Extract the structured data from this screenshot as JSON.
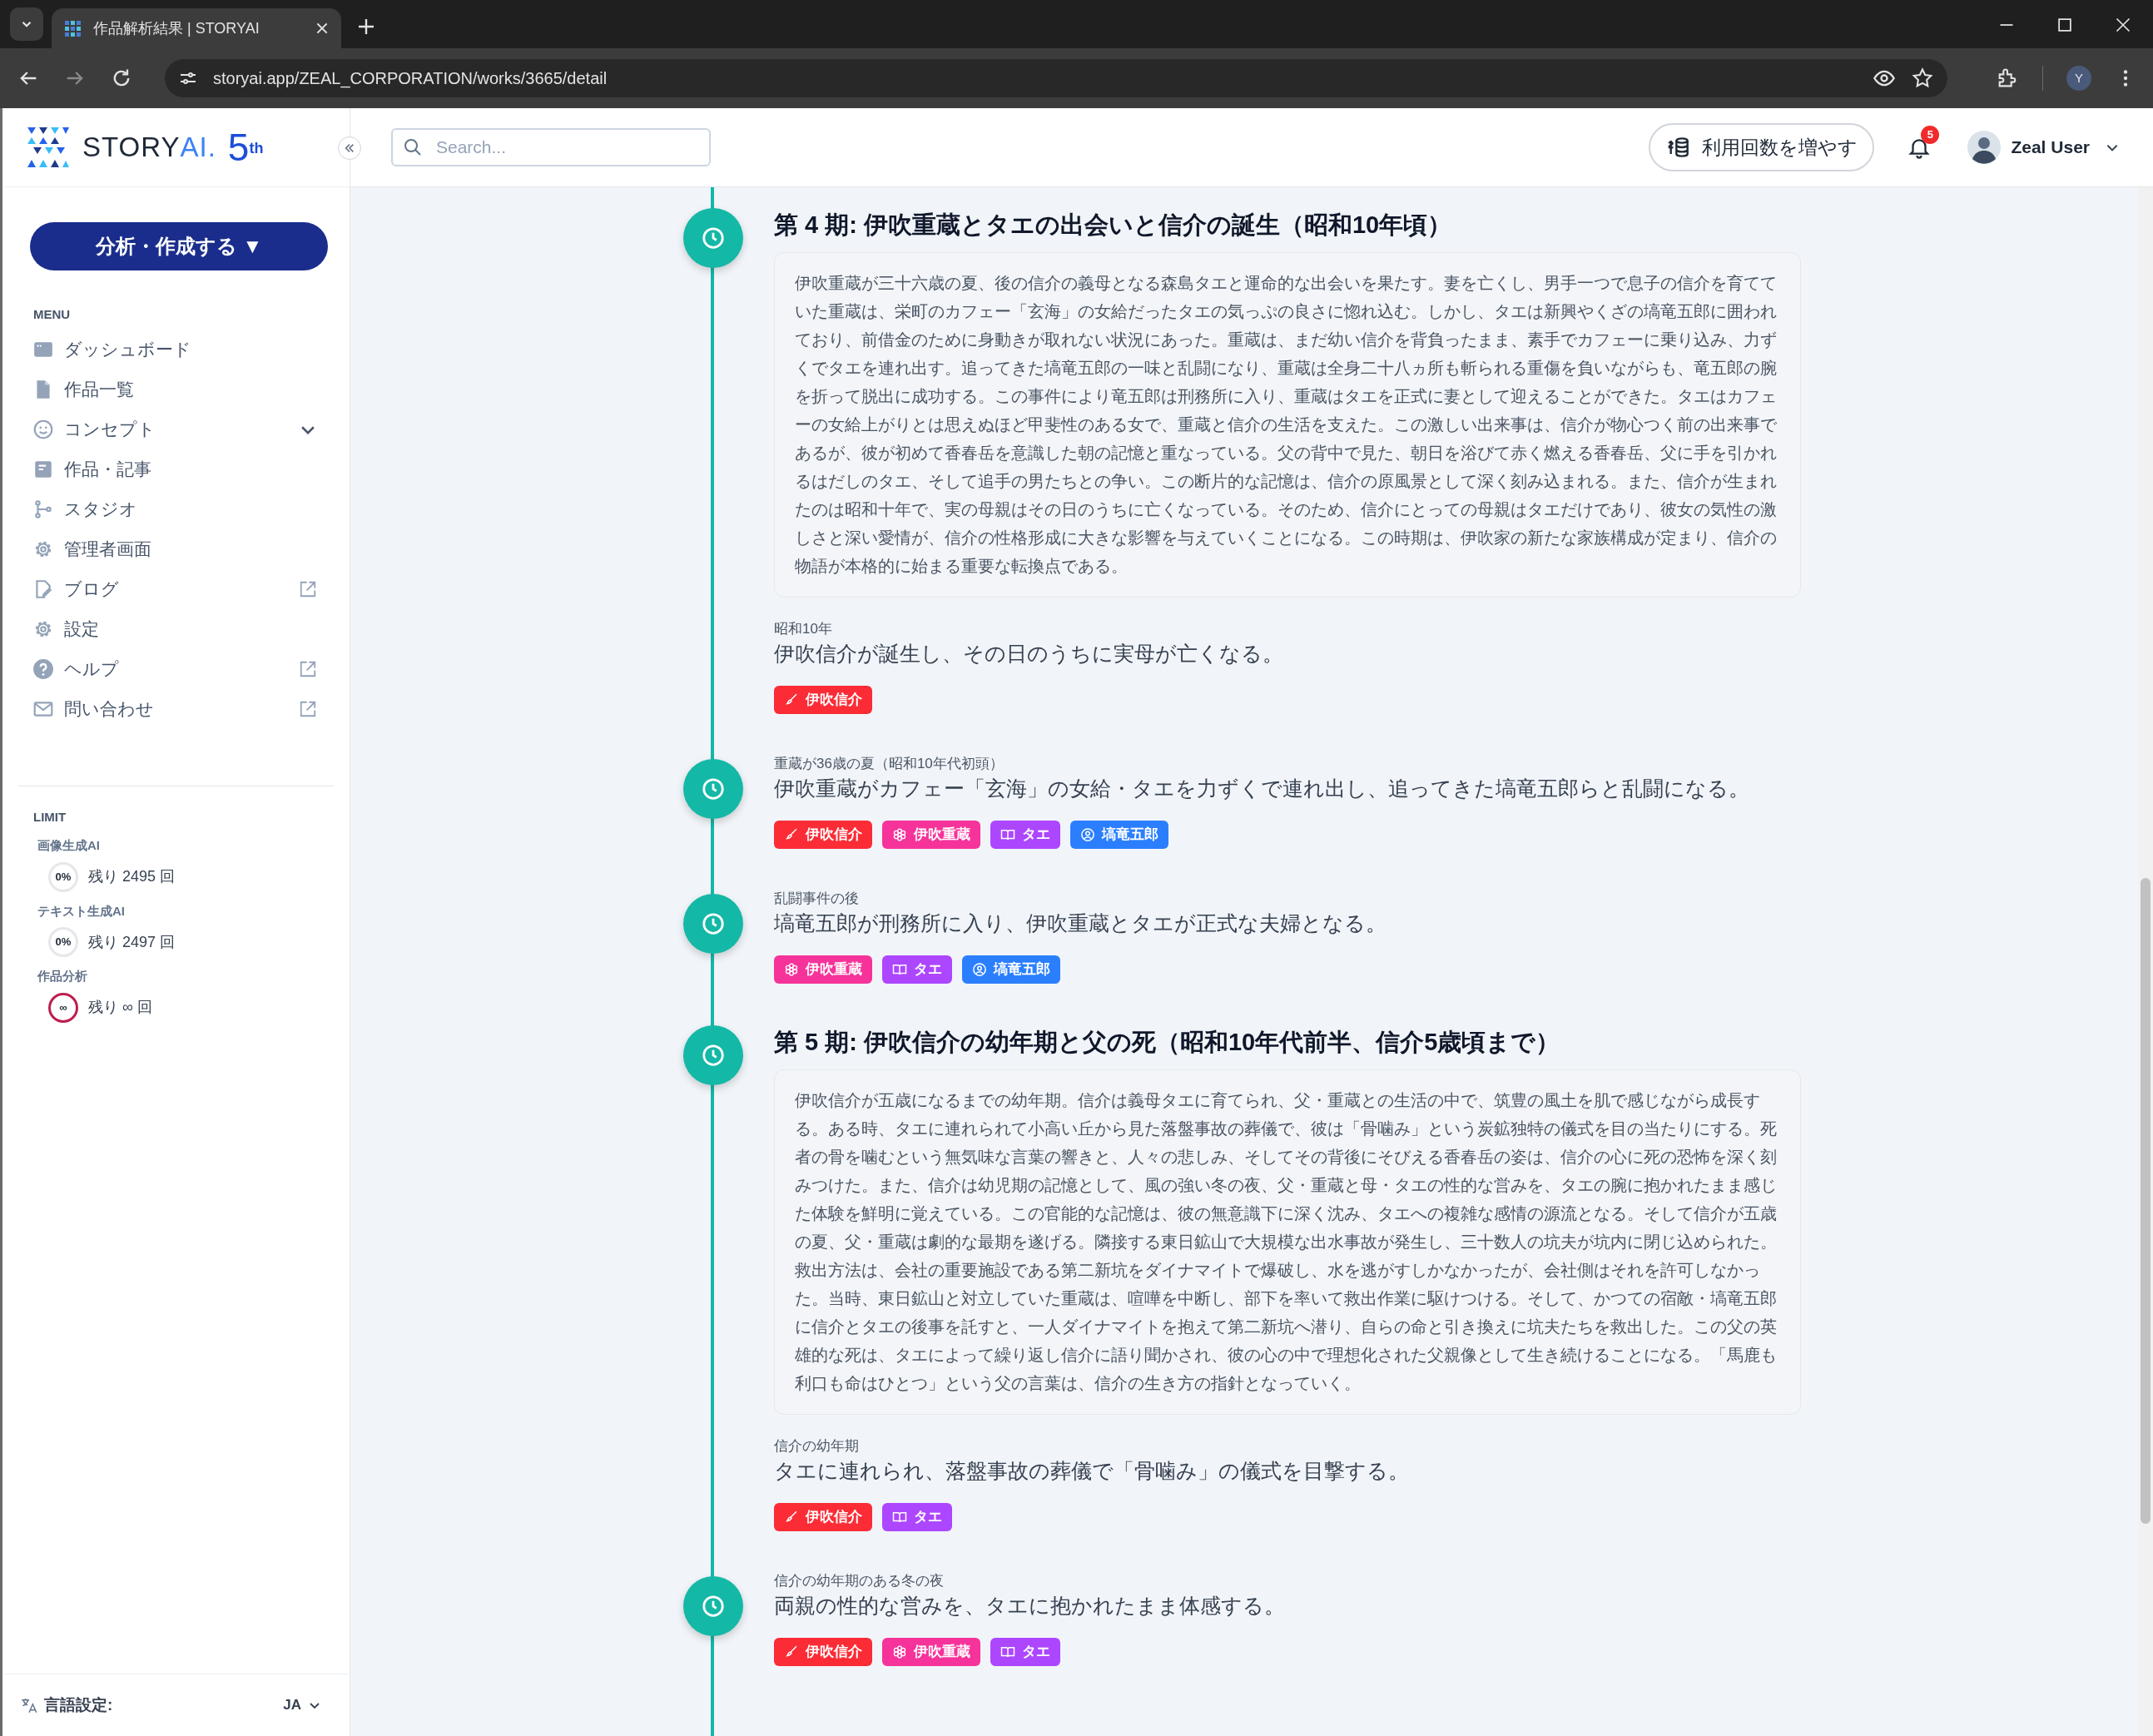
{
  "browser": {
    "tab_title": "作品解析結果 | STORYAI",
    "url": "storyai.app/ZEAL_CORPORATION/works/3665/detail",
    "profile_initial": "Y"
  },
  "sidebar": {
    "logo": {
      "brand": "STORY",
      "brand_accent": "AI.",
      "anniversary": "5$^{th}$"
    },
    "create_button": "分析・作成する ▼",
    "menu_heading": "MENU",
    "items": [
      {
        "label": "ダッシュボード",
        "external": false,
        "expandable": false
      },
      {
        "label": "作品一覧",
        "external": false,
        "expandable": false
      },
      {
        "label": "コンセプト",
        "external": false,
        "expandable": true
      },
      {
        "label": "作品・記事",
        "external": false,
        "expandable": false
      },
      {
        "label": "スタジオ",
        "external": false,
        "expandable": false
      },
      {
        "label": "管理者画面",
        "external": false,
        "expandable": false
      },
      {
        "label": "ブログ",
        "external": true,
        "expandable": false
      },
      {
        "label": "設定",
        "external": false,
        "expandable": false
      },
      {
        "label": "ヘルプ",
        "external": true,
        "expandable": false
      },
      {
        "label": "問い合わせ",
        "external": true,
        "expandable": false
      }
    ],
    "limit_heading": "LIMIT",
    "limits": [
      {
        "label": "画像生成AI",
        "kind": "percent",
        "meter": "0%",
        "remaining": "残り 2495 回"
      },
      {
        "label": "テキスト生成AI",
        "kind": "percent",
        "meter": "0%",
        "remaining": "残り 2497 回"
      },
      {
        "label": "作品分析",
        "kind": "unlimited",
        "meter": "∞",
        "remaining": "残り ∞ 回"
      }
    ],
    "language": {
      "label": "言語設定:",
      "value": "JA"
    }
  },
  "header": {
    "search": {
      "placeholder": "Search..."
    },
    "upgrade_button": "利用回数を増やす",
    "notification_count": "5",
    "user_name": "Zeal User"
  },
  "timeline": [
    {
      "kind": "period",
      "title": "第 4 期: 伊吹重蔵とタエの出会いと信介の誕生（昭和10年頃）",
      "description": "伊吹重蔵が三十六歳の夏、後の信介の義母となる森島タエと運命的な出会いを果たす。妻を亡くし、男手一つで息子の信介を育てていた重蔵は、栄町のカフェー「玄海」の女給だったタエの気っぷの良さに惚れ込む。しかし、タエは新興やくざの塙竜五郎に囲われており、前借金のために身動きが取れない状況にあった。重蔵は、まだ幼い信介を背負ったまま、素手でカフェーに乗り込み、力ずくでタエを連れ出す。追ってきた塙竜五郎の一味と乱闘になり、重蔵は全身二十八ヵ所も斬られる重傷を負いながらも、竜五郎の腕を折って脱出に成功する。この事件により竜五郎は刑務所に入り、重蔵はタエを正式に妻として迎えることができた。タエはカフェーの女給上がりとは思えぬほど甲斐性のある女で、重蔵と信介の生活を支えた。この激しい出来事は、信介が物心つく前の出来事であるが、彼が初めて香春岳を意識した朝の記憶と重なっている。父の背中で見た、朝日を浴びて赤く燃える香春岳、父に手を引かれるはだしのタエ、そして追手の男たちとの争い。この断片的な記憶は、信介の原風景として深く刻み込まれる。また、信介が生まれたのは昭和十年で、実の母親はその日のうちに亡くなっている。そのため、信介にとっての母親はタエだけであり、彼女の気性の激しさと深い愛情が、信介の性格形成に大きな影響を与えていくことになる。この時期は、伊吹家の新たな家族構成が定まり、信介の物語が本格的に始まる重要な転換点である。"
    },
    {
      "kind": "event",
      "marker": false,
      "date": "昭和10年",
      "text": "伊吹信介が誕生し、その日のうちに実母が亡くなる。",
      "tags": [
        {
          "label": "伊吹信介",
          "kind": "brush",
          "color": "#fb2c36"
        }
      ]
    },
    {
      "kind": "event",
      "marker": true,
      "date": "重蔵が36歳の夏（昭和10年代初頭）",
      "text": "伊吹重蔵がカフェー「玄海」の女給・タエを力ずくで連れ出し、追ってきた塙竜五郎らと乱闘になる。",
      "tags": [
        {
          "label": "伊吹信介",
          "kind": "brush",
          "color": "#fb2c36"
        },
        {
          "label": "伊吹重蔵",
          "kind": "flower",
          "color": "#f6339a"
        },
        {
          "label": "タエ",
          "kind": "book",
          "color": "#ad46ff"
        },
        {
          "label": "塙竜五郎",
          "kind": "person",
          "color": "#2b7fff"
        }
      ]
    },
    {
      "kind": "event",
      "marker": true,
      "date": "乱闘事件の後",
      "text": "塙竜五郎が刑務所に入り、伊吹重蔵とタエが正式な夫婦となる。",
      "tags": [
        {
          "label": "伊吹重蔵",
          "kind": "flower",
          "color": "#f6339a"
        },
        {
          "label": "タエ",
          "kind": "book",
          "color": "#ad46ff"
        },
        {
          "label": "塙竜五郎",
          "kind": "person",
          "color": "#2b7fff"
        }
      ]
    },
    {
      "kind": "period",
      "title": "第 5 期: 伊吹信介の幼年期と父の死（昭和10年代前半、信介5歳頃まで）",
      "description": "伊吹信介が五歳になるまでの幼年期。信介は義母タエに育てられ、父・重蔵との生活の中で、筑豊の風土を肌で感じながら成長する。ある時、タエに連れられて小高い丘から見た落盤事故の葬儀で、彼は「骨噛み」という炭鉱独特の儀式を目の当たりにする。死者の骨を噛むという無気味な言葉の響きと、人々の悲しみ、そしてその背後にそびえる香春岳の姿は、信介の心に死の恐怖を深く刻みつけた。また、信介は幼児期の記憶として、風の強い冬の夜、父・重蔵と母・タエの性的な営みを、タエの腕に抱かれたまま感じた体験を鮮明に覚えている。この官能的な記憶は、彼の無意識下に深く沈み、タエへの複雑な感情の源流となる。そして信介が五歳の夏、父・重蔵は劇的な最期を遂げる。隣接する東日鉱山で大規模な出水事故が発生し、三十数人の坑夫が坑内に閉じ込められた。救出方法は、会社の重要施設である第二新坑をダイナマイトで爆破し、水を逃がすしかなかったが、会社側はそれを許可しなかった。当時、東日鉱山と対立していた重蔵は、喧嘩を中断し、部下を率いて救出作業に駆けつける。そして、かつての宿敵・塙竜五郎に信介とタエの後事を託すと、一人ダイナマイトを抱えて第二新坑へ潜り、自らの命と引き換えに坑夫たちを救出した。この父の英雄的な死は、タエによって繰り返し信介に語り聞かされ、彼の心の中で理想化された父親像として生き続けることになる。「馬鹿も利口も命はひとつ」という父の言葉は、信介の生き方の指針となっていく。"
    },
    {
      "kind": "event",
      "marker": false,
      "date": "信介の幼年期",
      "text": "タエに連れられ、落盤事故の葬儀で「骨噛み」の儀式を目撃する。",
      "tags": [
        {
          "label": "伊吹信介",
          "kind": "brush",
          "color": "#fb2c36"
        },
        {
          "label": "タエ",
          "kind": "book",
          "color": "#ad46ff"
        }
      ]
    },
    {
      "kind": "event",
      "marker": true,
      "date": "信介の幼年期のある冬の夜",
      "text": "両親の性的な営みを、タエに抱かれたまま体感する。",
      "tags": [
        {
          "label": "伊吹信介",
          "kind": "brush",
          "color": "#fb2c36"
        },
        {
          "label": "伊吹重蔵",
          "kind": "flower",
          "color": "#f6339a"
        },
        {
          "label": "タエ",
          "kind": "book",
          "color": "#ad46ff"
        }
      ]
    }
  ]
}
